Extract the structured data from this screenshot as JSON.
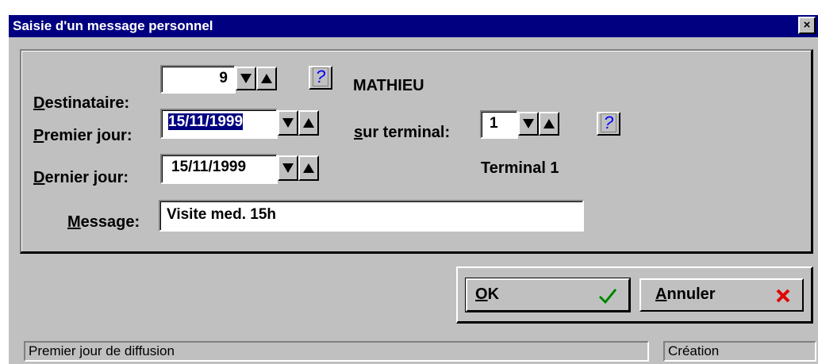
{
  "window": {
    "title": "Saisie d'un message personnel",
    "close_glyph": "×"
  },
  "form": {
    "destinataire": {
      "label_first": "D",
      "label_rest": "estinataire:",
      "value": "9",
      "name": "MATHIEU"
    },
    "premier_jour": {
      "label_first": "P",
      "label_rest": "remier jour:",
      "value": "15/11/1999"
    },
    "terminal": {
      "label_first": "s",
      "label_rest": "ur terminal:",
      "value": "1",
      "name": "Terminal 1"
    },
    "dernier_jour": {
      "label_first": "D",
      "label_rest": "ernier jour:",
      "value": "15/11/1999"
    },
    "message": {
      "label_first": "M",
      "label_rest": "essage:",
      "value": "Visite med.  15h"
    },
    "help_glyph": "?"
  },
  "buttons": {
    "ok": {
      "label_first": "O",
      "label_rest": "K",
      "icon": "check-icon"
    },
    "cancel": {
      "label_first": "A",
      "label_rest": "nnuler",
      "icon": "cross-icon"
    }
  },
  "statusbar": {
    "left": "Premier jour de diffusion",
    "right": "Création"
  },
  "colors": {
    "titlebar": "#000080",
    "face": "#c0c0c0",
    "check": "#00a000",
    "cross": "#e00000"
  }
}
